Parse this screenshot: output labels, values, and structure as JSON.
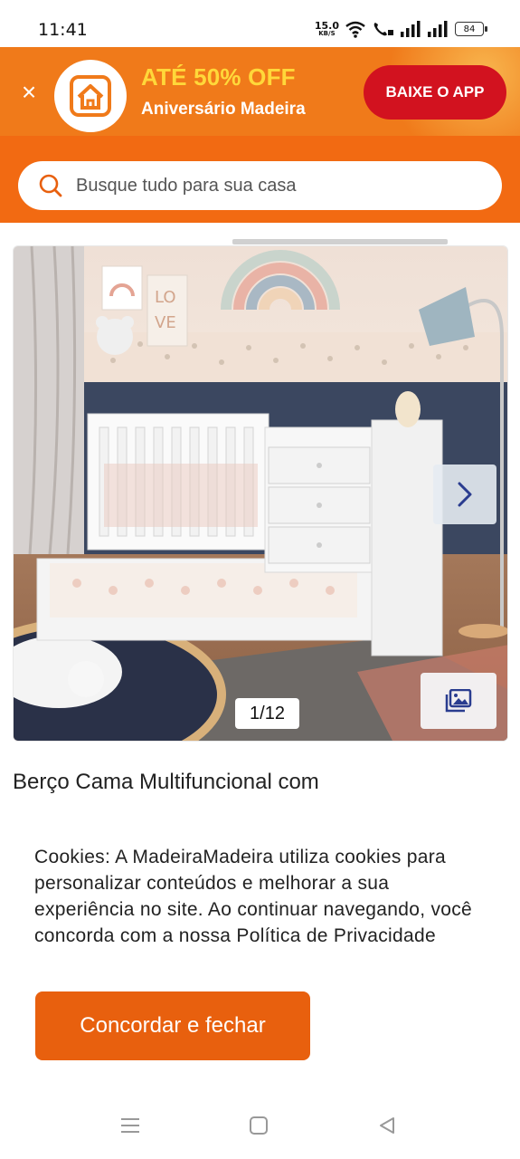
{
  "status_bar": {
    "time": "11:41",
    "net_speed": "15.0",
    "net_unit": "KB/S",
    "battery": "84"
  },
  "promo": {
    "title": "ATÉ 50% OFF",
    "subtitle": "Aniversário Madeira",
    "cta": "BAIXE O APP",
    "colors": {
      "background": "#f07a1a",
      "title": "#ffd83a",
      "cta": "#d2121f"
    }
  },
  "search": {
    "placeholder": "Busque tudo para sua casa"
  },
  "carousel": {
    "counter": "1/12",
    "next_icon": "chevron-right-icon",
    "gallery_icon": "image-gallery-icon"
  },
  "product": {
    "title": "Berço Cama Multifuncional com"
  },
  "cookie": {
    "text": "Cookies: A MadeiraMadeira utiliza cookies para personalizar conteúdos e melhorar a sua experiência no site. Ao continuar navegando, você concorda com a nossa Política de Privacidade",
    "button": "Concordar e fechar",
    "button_color": "#e8600e"
  },
  "nav": {
    "icons": [
      "menu-icon",
      "home-icon",
      "back-icon"
    ]
  }
}
